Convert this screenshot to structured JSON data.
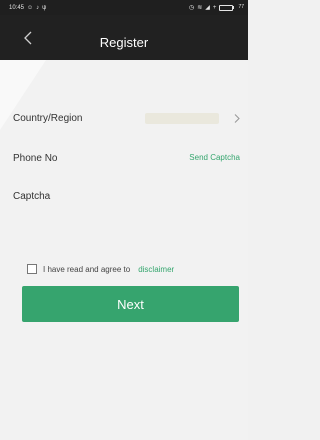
{
  "status_bar": {
    "time": "10:45",
    "battery_text": "77",
    "battery_level": 0.77
  },
  "header": {
    "title": "Register"
  },
  "form": {
    "country_label": "Country/Region",
    "phone_label": "Phone No",
    "send_captcha_label": "Send Captcha",
    "captcha_label": "Captcha"
  },
  "agreement": {
    "text": "I have read and agree to",
    "link": "disclaimer"
  },
  "next_button": {
    "label": "Next"
  },
  "colors": {
    "accent": "#36a46e",
    "header_bg": "#212121",
    "background": "#f2f2f2"
  }
}
